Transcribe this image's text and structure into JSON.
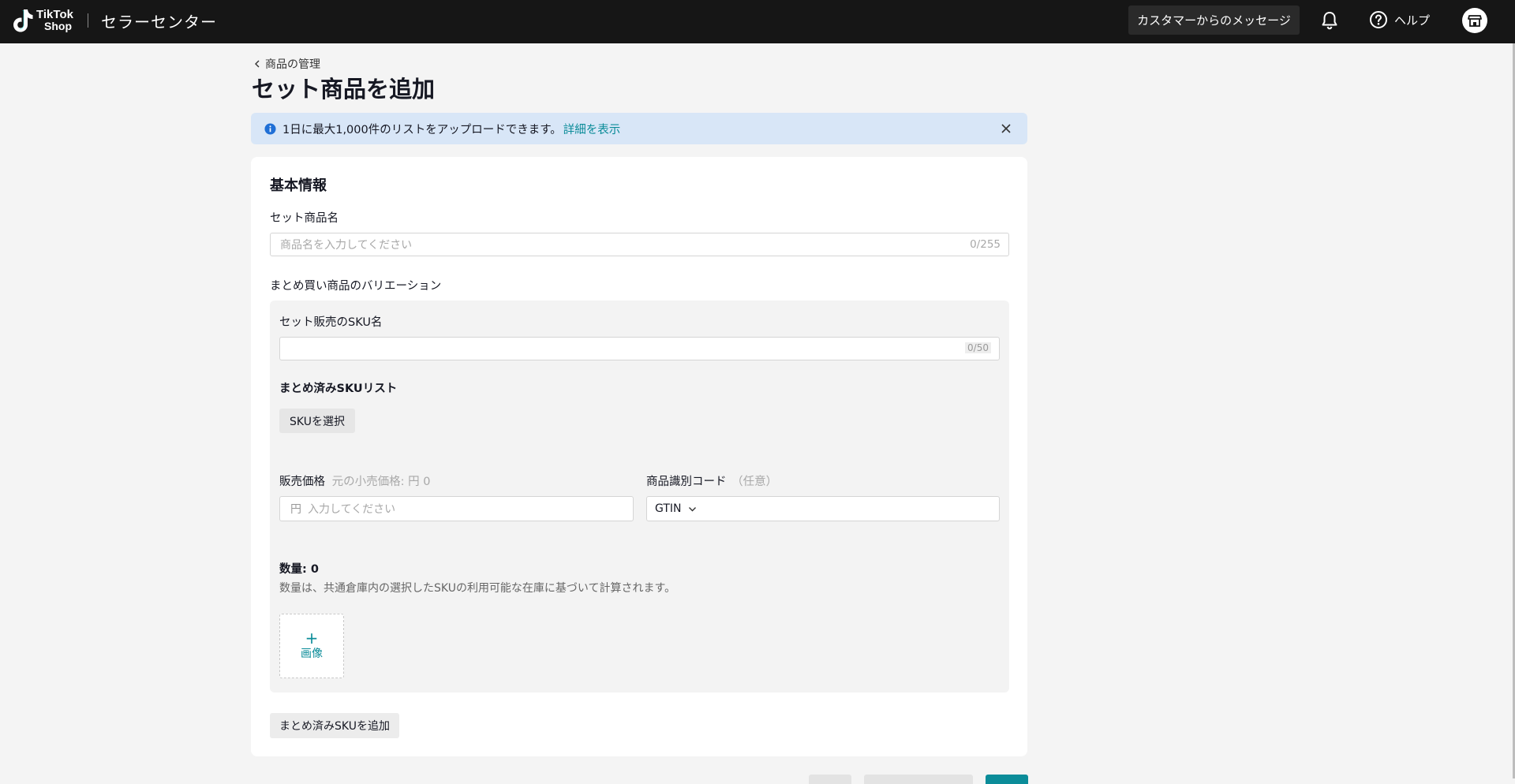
{
  "header": {
    "logo_line1": "TikTok",
    "logo_line2": "Shop",
    "title": "セラーセンター",
    "customer_messages": "カスタマーからのメッセージ",
    "help": "ヘルプ"
  },
  "page": {
    "breadcrumb": "商品の管理",
    "title": "セット商品を追加"
  },
  "banner": {
    "text": "1日に最大1,000件のリストをアップロードできます。",
    "link": "詳細を表示"
  },
  "basic_info": {
    "section_title": "基本情報",
    "name_label": "セット商品名",
    "name_placeholder": "商品名を入力してください",
    "name_count": "0/255",
    "variations_label": "まとめ買い商品のバリエーション"
  },
  "variant": {
    "sku_name_label": "セット販売のSKU名",
    "sku_name_count": "0/50",
    "bundled_list_label": "まとめ済みSKUリスト",
    "select_sku": "SKUを選択",
    "price_label": "販売価格",
    "price_hint": "元の小売価格: 円 0",
    "price_prefix": "円",
    "price_placeholder": "入力してください",
    "code_label": "商品識別コード",
    "code_optional": "（任意）",
    "code_type": "GTIN",
    "quantity": "数量: 0",
    "quantity_note": "数量は、共通倉庫内の選択したSKUの利用可能な在庫に基づいて計算されます。",
    "image_plus": "+",
    "image_label": "画像"
  },
  "add_bundled_sku": "まとめ済みSKUを追加",
  "colors": {
    "accent": "#0b8c99",
    "header_bg": "#161616",
    "banner_bg": "#d8e6f7"
  }
}
